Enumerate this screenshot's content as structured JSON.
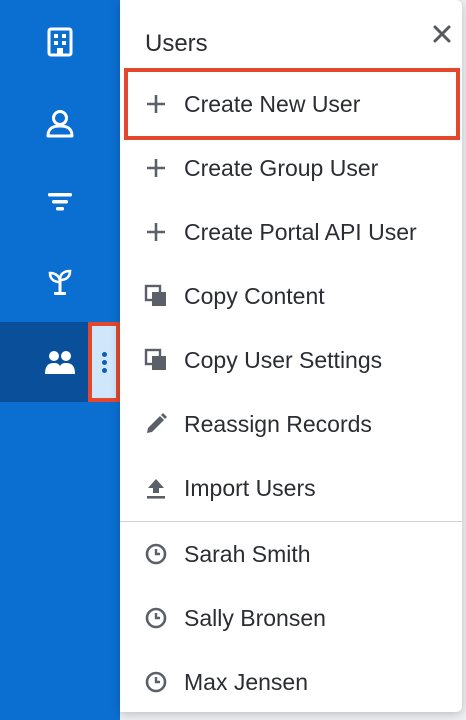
{
  "sidebar": {
    "items": [
      {
        "icon": "building-icon"
      },
      {
        "icon": "user-icon"
      },
      {
        "icon": "filter-icon"
      },
      {
        "icon": "sprout-icon"
      },
      {
        "icon": "users-icon"
      }
    ],
    "accent": "#0b6fd1",
    "active_bg": "#0a4f9a"
  },
  "menu": {
    "title": "Users",
    "close_icon": "close-icon",
    "actions": [
      {
        "label": "Create New User",
        "icon": "plus-icon"
      },
      {
        "label": "Create Group User",
        "icon": "plus-icon"
      },
      {
        "label": "Create Portal API User",
        "icon": "plus-icon"
      },
      {
        "label": "Copy Content",
        "icon": "copy-icon"
      },
      {
        "label": "Copy User Settings",
        "icon": "copy-icon"
      },
      {
        "label": "Reassign Records",
        "icon": "pencil-icon"
      },
      {
        "label": "Import Users",
        "icon": "upload-icon"
      }
    ],
    "recent": [
      {
        "label": "Sarah Smith",
        "icon": "clock-icon"
      },
      {
        "label": "Sally Bronsen",
        "icon": "clock-icon"
      },
      {
        "label": "Max Jensen",
        "icon": "clock-icon"
      }
    ]
  },
  "highlight_color": "#e3472e"
}
